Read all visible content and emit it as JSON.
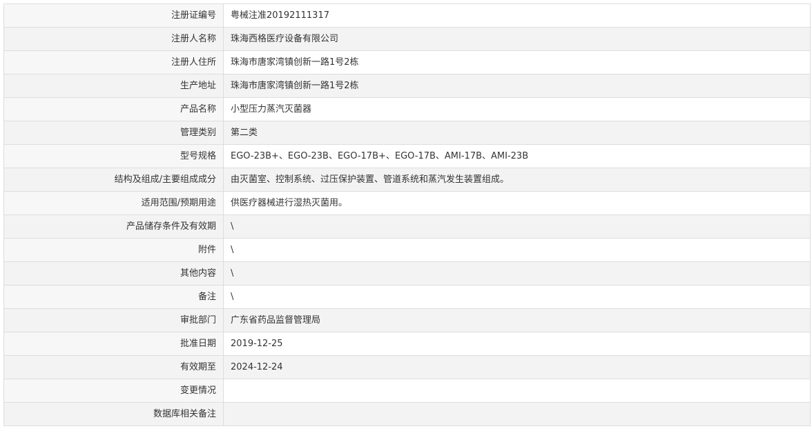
{
  "rows": [
    {
      "label": "注册证编号",
      "value": "粤械注准20192111317"
    },
    {
      "label": "注册人名称",
      "value": "珠海西格医疗设备有限公司"
    },
    {
      "label": "注册人住所",
      "value": "珠海市唐家湾镇创新一路1号2栋"
    },
    {
      "label": "生产地址",
      "value": "珠海市唐家湾镇创新一路1号2栋"
    },
    {
      "label": "产品名称",
      "value": "小型压力蒸汽灭菌器"
    },
    {
      "label": "管理类别",
      "value": "第二类"
    },
    {
      "label": "型号规格",
      "value": "EGO-23B+、EGO-23B、EGO-17B+、EGO-17B、AMI-17B、AMI-23B"
    },
    {
      "label": "结构及组成/主要组成成分",
      "value": "由灭菌室、控制系统、过压保护装置、管道系统和蒸汽发生装置组成。"
    },
    {
      "label": "适用范围/预期用途",
      "value": "供医疗器械进行湿热灭菌用。"
    },
    {
      "label": "产品储存条件及有效期",
      "value": "\\"
    },
    {
      "label": "附件",
      "value": "\\"
    },
    {
      "label": "其他内容",
      "value": "\\"
    },
    {
      "label": "备注",
      "value": "\\"
    },
    {
      "label": "审批部门",
      "value": "广东省药品监督管理局"
    },
    {
      "label": "批准日期",
      "value": "2019-12-25"
    },
    {
      "label": "有效期至",
      "value": "2024-12-24"
    },
    {
      "label": "变更情况",
      "value": ""
    },
    {
      "label": "数据库相关备注",
      "value": ""
    }
  ]
}
